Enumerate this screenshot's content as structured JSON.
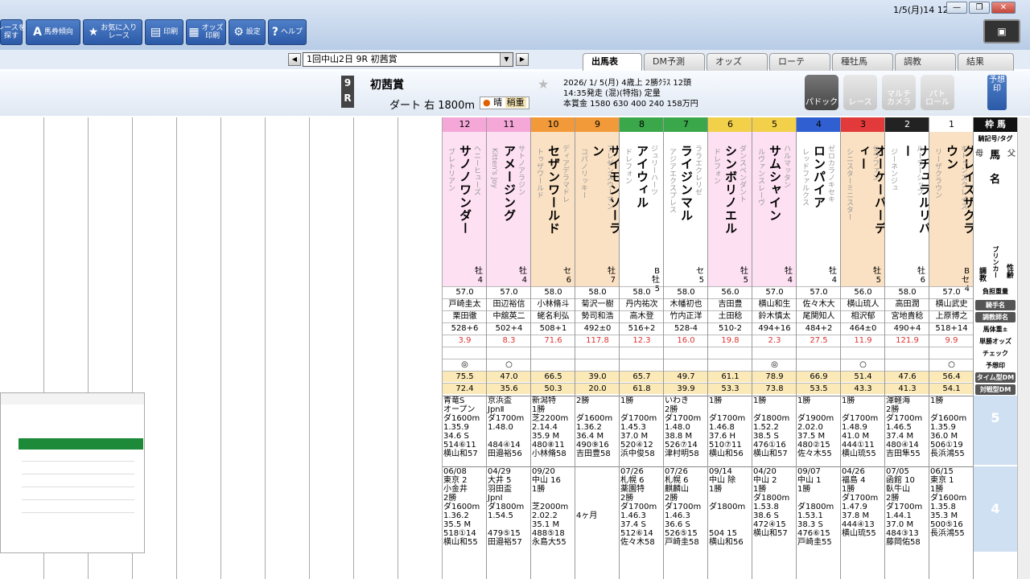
{
  "toolbar": {
    "buttons": [
      {
        "label": "レースを\n探す",
        "icon": "search-race-icon"
      },
      {
        "label": "馬券傾向",
        "icon": "trend-icon"
      },
      {
        "label": "お気に入り\nレース",
        "icon": "star-icon"
      },
      {
        "label": "印刷",
        "icon": "print-icon"
      },
      {
        "label": "オッズ\n印刷",
        "icon": "odds-print-icon"
      },
      {
        "label": "設定",
        "icon": "gear-icon"
      },
      {
        "label": "ヘルプ",
        "icon": "help-icon"
      }
    ]
  },
  "datetime": "1/5(月)14 12",
  "race_select": "1回中山2日 9R 初茜賞",
  "tabs": [
    "出馬表",
    "DM予測",
    "オッズ",
    "ローテ",
    "種牡馬",
    "調教",
    "結果"
  ],
  "race": {
    "num_top": "9",
    "num_bottom": "R",
    "name": "初茜賞",
    "course": "ダート 右 1800m",
    "weather": "晴",
    "going": "稍重",
    "info1": "2026/ 1/ 5(月) 4歳上 2勝ｸﾗｽ 12頭",
    "info2": "14:35発走 (混)(特指) 定量",
    "info3": "本賞金 1580 630 400 240 158万円"
  },
  "buttons": {
    "paddock": "パドック",
    "race": "レース",
    "multi": "マルチ\nカメラ",
    "patrol": "パト\nロール",
    "yoso": "予想印"
  },
  "labels": {
    "head": "枠 馬",
    "r1": "騎記号/タグ",
    "haha": "母",
    "chichi": "父",
    "uma": "馬",
    "mei": "名",
    "blinker": "ブリンカー",
    "seirei": "性齢",
    "chokyo": "調教",
    "r_kinryo": "負担重量",
    "r_kishu": "騎手名",
    "r_chokyo": "調教師名",
    "r_weight": "馬体重±",
    "r_odds": "単勝オッズ",
    "r_check": "チェック",
    "r_yoso": "予想印",
    "r_time": "タイム型DM",
    "r_taisen": "対戦型DM",
    "w5": "5",
    "w4": "4"
  },
  "horses": [
    {
      "waku": "",
      "umaban": "",
      "name": "",
      "sire": "",
      "dam": "",
      "sexage": "",
      "kinryo": "",
      "jockey": "",
      "trainer": "",
      "weight": "",
      "odds": "",
      "mark": "",
      "time_dm": "",
      "taisen_dm": "",
      "p1": "",
      "p2": ""
    },
    {
      "waku": "8",
      "umaban": "12",
      "name": "サノノワンダー",
      "sire": "ヘニーヒューズ",
      "dam": "ブレトリアン",
      "sexage": "牡\n4",
      "kinryo": "57.0",
      "jockey": "戸崎圭太",
      "trainer": "栗田徹",
      "weight": "528+6",
      "odds": "3.9",
      "mark": "◎",
      "time_dm": "75.5",
      "taisen_dm": "72.4",
      "p1": "青竜S\nオープン\nダ1600m\n1.35.9\n34.6 S\n514⑥11\n横山和57",
      "p2": "06/08\n東京 2\n小金井\n2勝\nダ1600m\n1.36.2\n35.5 M\n518①14\n横山和55"
    },
    {
      "waku": "8",
      "umaban": "11",
      "name": "アメージング",
      "sire": "サトノアラジン",
      "dam": "Kitten's Joy",
      "sexage": "牡\n4",
      "kinryo": "57.0",
      "jockey": "田辺裕信",
      "trainer": "中舘英二",
      "weight": "502+4",
      "odds": "8.3",
      "mark": "○",
      "time_dm": "47.0",
      "taisen_dm": "35.6",
      "p1": "京浜盃\nJpnⅡ\nダ1700m\n1.48.0\n\n484④14\n田邉裕56",
      "p2": "04/29\n大井 5\n羽田盃\nJpnⅠ\nダ1800m\n1.54.5\n\n479⑤15\n田邉裕57"
    },
    {
      "waku": "7",
      "umaban": "10",
      "name": "セザンワールド",
      "sire": "ディアデラマドレ",
      "dam": "トゥザワールド",
      "sexage": "セ\n6",
      "kinryo": "58.0",
      "jockey": "小林脩斗",
      "trainer": "蛯名利弘",
      "weight": "508+1",
      "odds": "71.6",
      "mark": "",
      "time_dm": "66.5",
      "taisen_dm": "50.3",
      "p1": "新潟特\n1勝\n芝2200m\n2.14.4\n35.9 M\n480⑧11\n小林脩58",
      "p2": "09/20\n中山 16\n1勝\n\n芝2000m\n2.02.2\n35.1 M\n488⑤18\n永島大55"
    },
    {
      "waku": "7",
      "umaban": "9",
      "name": "サイモンソーラン",
      "sire": "フレゼンスウーマン",
      "dam": "コパノリッキー",
      "sexage": "牡\n7",
      "kinryo": "58.0",
      "jockey": "菊沢一樹",
      "trainer": "勢司和浩",
      "weight": "492±0",
      "odds": "117.8",
      "mark": "",
      "time_dm": "39.0",
      "taisen_dm": "20.0",
      "p1": "2勝\n\nダ1600m\n1.36.2\n36.4 M\n490⑨16\n吉田豊58",
      "p2": "\n\n\n\n\n4ヶ月"
    },
    {
      "waku": "6",
      "umaban": "8",
      "name": "アイウィル",
      "sire": "ジュリーハーツ",
      "dam": "ドレフォン",
      "sexage": "B\n牡\n5",
      "kinryo": "58.0",
      "jockey": "丹内祐次",
      "trainer": "高木登",
      "weight": "516+2",
      "odds": "12.3",
      "mark": "",
      "time_dm": "65.7",
      "taisen_dm": "61.8",
      "p1": "1勝\n\nダ1700m\n1.45.3\n37.0 M\n520④12\n浜中俊58",
      "p2": "07/26\n札幌 6\n薬園特\n2勝\nダ1700m\n1.46.3\n37.4 S\n512⑥14\n佐々木58"
    },
    {
      "waku": "6",
      "umaban": "7",
      "name": "ライジンマル",
      "sire": "ララエクレリゼ",
      "dam": "アジアエクスプレス",
      "sexage": "セ\n5",
      "kinryo": "58.0",
      "jockey": "木幡初也",
      "trainer": "竹内正洋",
      "weight": "528-4",
      "odds": "16.0",
      "mark": "",
      "time_dm": "49.7",
      "taisen_dm": "39.9",
      "p1": "いわき\n2勝\nダ1700m\n1.48.0\n38.8 M\n526⑦14\n津村明58",
      "p2": "07/26\n札幌 6\n麒麟山\n2勝\nダ1700m\n1.46.3\n36.6 S\n526⑤15\n戸崎圭58"
    },
    {
      "waku": "5",
      "umaban": "6",
      "name": "シンボリノエル",
      "sire": "ダンスペンダント",
      "dam": "ドレフォン",
      "sexage": "牡\n5",
      "kinryo": "56.0",
      "jockey": "吉田豊",
      "trainer": "土田稔",
      "weight": "510-2",
      "odds": "19.8",
      "mark": "",
      "time_dm": "61.1",
      "taisen_dm": "53.3",
      "p1": "1勝\n\nダ1700m\n1.46.8\n37.6 H\n510⑦11\n横山和56",
      "p2": "09/14\n中山 除\n1勝\n\nダ1800m\n\n\n504 15\n横山和56"
    },
    {
      "waku": "5",
      "umaban": "5",
      "name": "サムシャイン",
      "sire": "ハルマッタン",
      "dam": "ルヴァンスレーヴ",
      "sexage": "牡\n4",
      "kinryo": "57.0",
      "jockey": "横山和生",
      "trainer": "鈴木慎太",
      "weight": "494+16",
      "odds": "2.3",
      "mark": "◎",
      "time_dm": "78.9",
      "taisen_dm": "73.8",
      "p1": "1勝\n\nダ1800m\n1.52.2\n38.5 S\n476①16\n横山和57",
      "p2": "04/20\n中山 2\n1勝\nダ1800m\n1.53.8\n38.6 S\n472④15\n横山和57"
    },
    {
      "waku": "4",
      "umaban": "4",
      "name": "ロンパイア",
      "sire": "ゼロカラノキセキ",
      "dam": "レッドファルクス",
      "sexage": "牡\n4",
      "kinryo": "57.0",
      "jockey": "佐々木大",
      "trainer": "尾関知人",
      "weight": "484+2",
      "odds": "27.5",
      "mark": "",
      "time_dm": "66.9",
      "taisen_dm": "53.5",
      "p1": "1勝\n\nダ1900m\n2.02.0\n37.5 M\n480②15\n佐々木55",
      "p2": "09/07\n中山 1\n1勝\n\nダ1800m\n1.53.1\n38.3 S\n476⑥15\n戸崎圭55"
    },
    {
      "waku": "3",
      "umaban": "3",
      "name": "オーケーバーディー",
      "sire": "セラファン",
      "dam": "シニスターミニスター",
      "sexage": "牡\n5",
      "kinryo": "56.0",
      "jockey": "横山琉人",
      "trainer": "相沢郁",
      "weight": "464±0",
      "odds": "11.9",
      "mark": "○",
      "time_dm": "51.4",
      "taisen_dm": "43.3",
      "p1": "1勝\n\nダ1700m\n1.48.9\n41.0 M\n444①11\n横山琉55",
      "p2": "04/26\n福島 4\n1勝\nダ1700m\n1.47.9\n37.8 M\n444④13\n横山琉55"
    },
    {
      "waku": "2",
      "umaban": "2",
      "name": "ナチュラルリバー",
      "sire": "ルーラーシップ",
      "dam": "ジーネンジュ",
      "sexage": "牡\n6",
      "kinryo": "58.0",
      "jockey": "高田潤",
      "trainer": "宮地貴稔",
      "weight": "490+4",
      "odds": "121.9",
      "mark": "",
      "time_dm": "47.6",
      "taisen_dm": "41.3",
      "p1": "渾軽海\n2勝\nダ1700m\n1.46.5\n37.4 M\n480④14\n吉田隼55",
      "p2": "07/05\n函館 10\n臥牛山\n2勝\nダ1700m\n1.44.1\n37.0 M\n484③13\n藤岡佑58"
    },
    {
      "waku": "1",
      "umaban": "1",
      "name": "グレイスザクラウン",
      "sire": "キトゥンズクレイス",
      "dam": "リーザクラウン",
      "sexage": "B\nセ\n4",
      "kinryo": "57.0",
      "jockey": "横山武史",
      "trainer": "上原博之",
      "weight": "518+14",
      "odds": "9.9",
      "mark": "○",
      "time_dm": "56.4",
      "taisen_dm": "54.1",
      "p1": "1勝\n\nダ1600m\n1.35.9\n36.0 M\n506①19\n長浜鴻55",
      "p2": "06/15\n東京 1\n1勝\nダ1600m\n1.35.8\n35.3 M\n500⑤16\n長浜鴻55"
    }
  ],
  "colors": {
    "w1": "#ffffff",
    "w2": "#222222",
    "w3": "#e23a3a",
    "w4": "#2f5fd0",
    "w5": "#f2d04a",
    "w6": "#3aa84a",
    "w7": "#f29a3a",
    "w8": "#f5a8d8",
    "pink": "#fde0f2",
    "orange": "#fbe1c3",
    "accent": "#2c5aa8"
  }
}
